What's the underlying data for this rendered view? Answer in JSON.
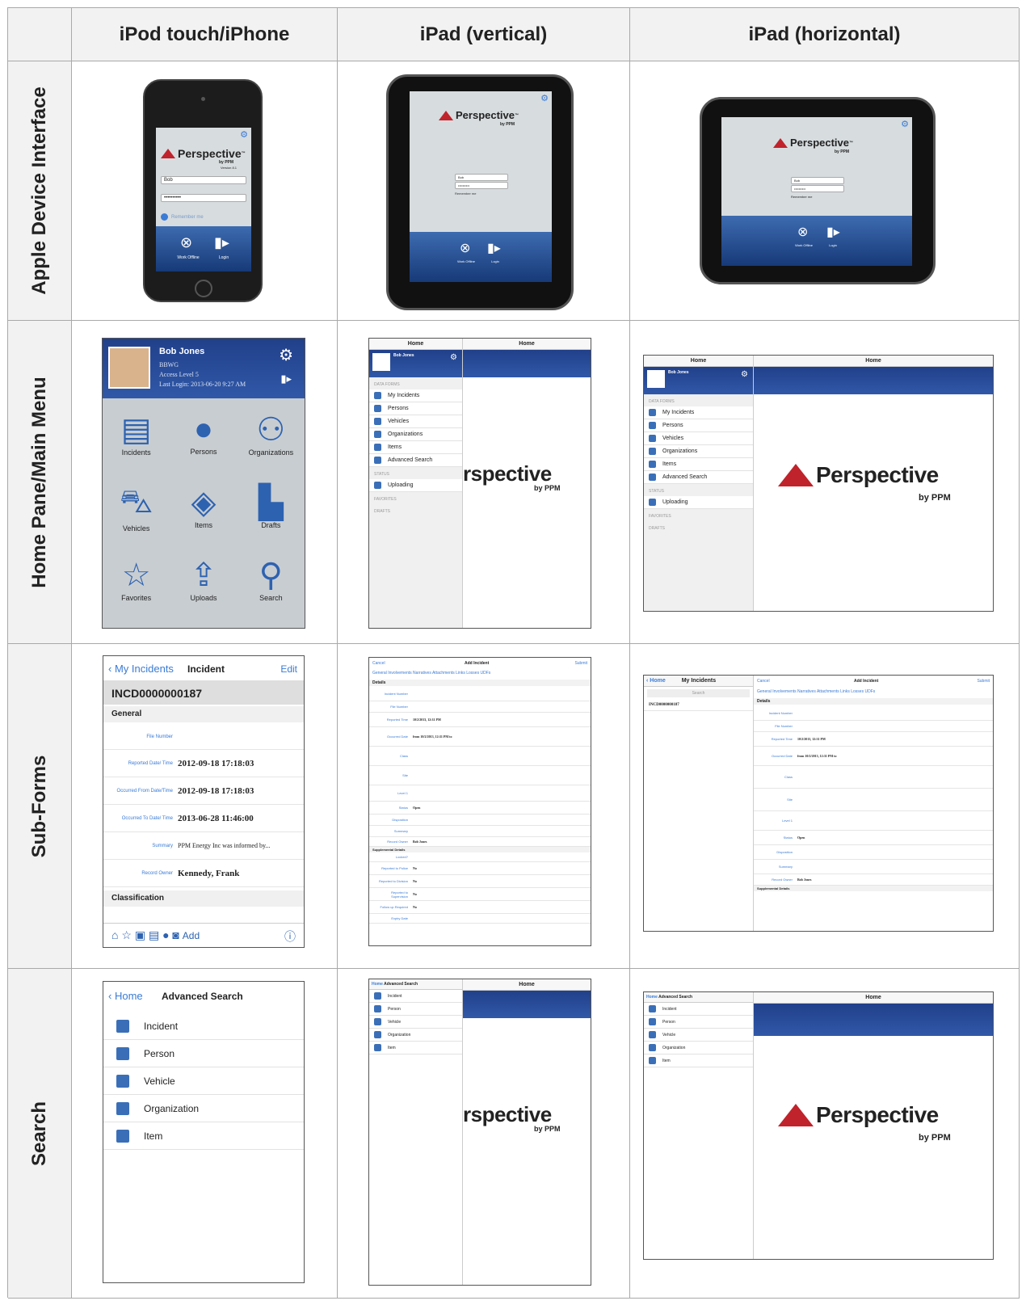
{
  "columns": [
    "iPod touch/iPhone",
    "iPad (vertical)",
    "iPad (horizontal)"
  ],
  "rows": [
    "Apple Device Interface",
    "Home Pane/Main Menu",
    "Sub-Forms",
    "Search"
  ],
  "login": {
    "app": "Perspective",
    "tm": "™",
    "by": "by PPM",
    "version": "Version 8.1",
    "user": "Bob",
    "password": "••••••••••",
    "remember": "Remember me",
    "work_offline": "Work Offline",
    "login": "Login"
  },
  "home": {
    "name": "Bob Jones",
    "org": "BBWG",
    "access": "Access Level 5",
    "last_login": "Last Login: 2013-06-20 9:27 AM",
    "tiles": [
      "Incidents",
      "Persons",
      "Organizations",
      "Vehicles",
      "Items",
      "Drafts",
      "Favorites",
      "Uploads",
      "Search"
    ],
    "left_title": "Home",
    "right_title": "Home",
    "data_forms": "DATA FORMS",
    "status": "STATUS",
    "favorites": "FAVORITES",
    "drafts": "DRAFTS",
    "menu": [
      "My Incidents",
      "Persons",
      "Vehicles",
      "Organizations",
      "Items",
      "Advanced Search"
    ],
    "uploading": "Uploading",
    "big_logo_partial": "rspective",
    "big_logo": "Perspective"
  },
  "incident": {
    "back": "My Incidents",
    "title": "Incident",
    "edit": "Edit",
    "id": "INCD0000000187",
    "general": "General",
    "fields": [
      {
        "k": "File Number",
        "v": ""
      },
      {
        "k": "Reported Date/ Time",
        "v": "2012-09-18 17:18:03"
      },
      {
        "k": "Occurred From Date/Time",
        "v": "2012-09-18 17:18:03"
      },
      {
        "k": "Occurred To Date/ Time",
        "v": "2013-06-28 11:46:00"
      },
      {
        "k": "Summary",
        "v": "PPM Energy Inc was informed by..."
      },
      {
        "k": "Record Owner",
        "v": "Kennedy, Frank"
      }
    ],
    "classification": "Classification",
    "add": "Add"
  },
  "add_incident": {
    "cancel": "Cancel",
    "title": "Add Incident",
    "submit": "Submit",
    "tabs": [
      "General",
      "Involvements",
      "Narratives",
      "Attachments",
      "Links",
      "Losses",
      "UDFs"
    ],
    "details": "Details",
    "fields": [
      {
        "k": "Incident Number",
        "v": ""
      },
      {
        "k": "File Number",
        "v": ""
      },
      {
        "k": "Reported Time",
        "v": "10/2/2013, 12:31 PM"
      },
      {
        "k": "Occurred Date",
        "v": "from 10/2/2013, 12:31 PM to"
      },
      {
        "k": "Class",
        "v": ""
      },
      {
        "k": "Site",
        "v": ""
      },
      {
        "k": "Level 1",
        "v": ""
      },
      {
        "k": "Status",
        "v": "Open"
      },
      {
        "k": "Disposition",
        "v": ""
      },
      {
        "k": "Summary",
        "v": ""
      },
      {
        "k": "Record Owner",
        "v": "Bob Jones"
      }
    ],
    "supplemental": "Supplemental Details",
    "yesno": [
      {
        "k": "Locked?",
        "v": ""
      },
      {
        "k": "Reported to Police",
        "v": "No"
      },
      {
        "k": "Reported to Division",
        "v": "No"
      },
      {
        "k": "Reported to Supervision",
        "v": "No"
      },
      {
        "k": "Follow up Required",
        "v": "No"
      },
      {
        "k": "Expiry Date",
        "v": ""
      }
    ],
    "list_title": "My Incidents",
    "search": "Search",
    "list_item": "INCD0000000187"
  },
  "search": {
    "back": "Home",
    "title": "Advanced Search",
    "items": [
      "Incident",
      "Person",
      "Vehicle",
      "Organization",
      "Item"
    ],
    "right_title": "Home"
  }
}
